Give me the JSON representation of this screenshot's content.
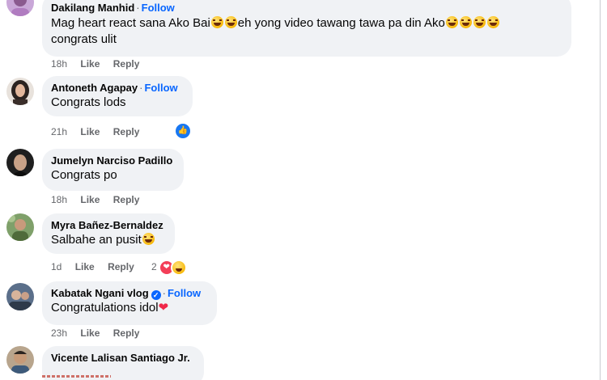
{
  "comments": [
    {
      "author": "Dakilang Manhid",
      "follow": "Follow",
      "text_1": "Mag heart react sana Ako Bai",
      "text_2": "eh yong video tawang tawa pa din Ako",
      "text_3": "congrats ulit",
      "time": "18h",
      "like": "Like",
      "reply": "Reply",
      "avatar_icon": "avatar-purple-photo"
    },
    {
      "author": "Antoneth Agapay",
      "follow": "Follow",
      "text": "Congrats lods",
      "time": "21h",
      "like": "Like",
      "reply": "Reply",
      "reaction_icon": "like-icon"
    },
    {
      "author": "Jumelyn Narciso Padillo",
      "text": "Congrats po",
      "time": "18h",
      "like": "Like",
      "reply": "Reply"
    },
    {
      "author": "Myra Bañez-Bernaldez",
      "text": "Salbahe an pusit",
      "time": "1d",
      "like": "Like",
      "reply": "Reply",
      "reaction_count": "2",
      "reaction_icons": [
        "heart-icon",
        "haha-icon"
      ]
    },
    {
      "author": "Kabatak Ngani vlog",
      "follow": "Follow",
      "text": "Congratulations idol",
      "time": "23h",
      "like": "Like",
      "reply": "Reply",
      "verified": true
    },
    {
      "author": "Vicente Lalisan Santiago Jr."
    }
  ],
  "colors": {
    "bubble": "#f0f2f5",
    "follow": "#0866ff",
    "meta": "#65676b",
    "heart": "#f02849"
  }
}
